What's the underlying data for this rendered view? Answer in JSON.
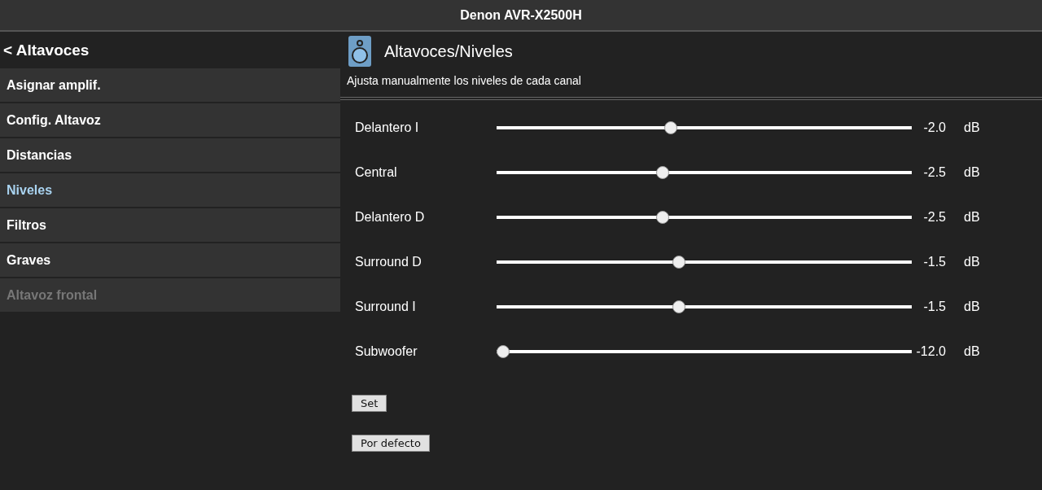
{
  "window": {
    "title": "Denon AVR-X2500H"
  },
  "sidebar": {
    "back": "< Altavoces",
    "items": [
      {
        "label": "Asignar amplif.",
        "selected": false,
        "disabled": false
      },
      {
        "label": "Config. Altavoz",
        "selected": false,
        "disabled": false
      },
      {
        "label": "Distancias",
        "selected": false,
        "disabled": false
      },
      {
        "label": "Niveles",
        "selected": true,
        "disabled": false
      },
      {
        "label": "Filtros",
        "selected": false,
        "disabled": false
      },
      {
        "label": "Graves",
        "selected": false,
        "disabled": false
      },
      {
        "label": "Altavoz frontal",
        "selected": false,
        "disabled": true
      }
    ]
  },
  "panel": {
    "title": "Altavoces/Niveles",
    "description": "Ajusta manualmente los niveles de cada canal",
    "channels": [
      {
        "name": "Delantero I",
        "level": 0.417,
        "reading": "-2.0",
        "unit": "dB"
      },
      {
        "name": "Central",
        "level": 0.396,
        "reading": "-2.5",
        "unit": "dB"
      },
      {
        "name": "Delantero D",
        "level": 0.396,
        "reading": "-2.5",
        "unit": "dB"
      },
      {
        "name": "Surround D",
        "level": 0.438,
        "reading": "-1.5",
        "unit": "dB"
      },
      {
        "name": "Surround I",
        "level": 0.438,
        "reading": "-1.5",
        "unit": "dB"
      },
      {
        "name": "Subwoofer",
        "level": 0,
        "reading": "-12.0",
        "unit": "dB"
      }
    ],
    "buttons": [
      "Set",
      "Por defecto"
    ]
  }
}
